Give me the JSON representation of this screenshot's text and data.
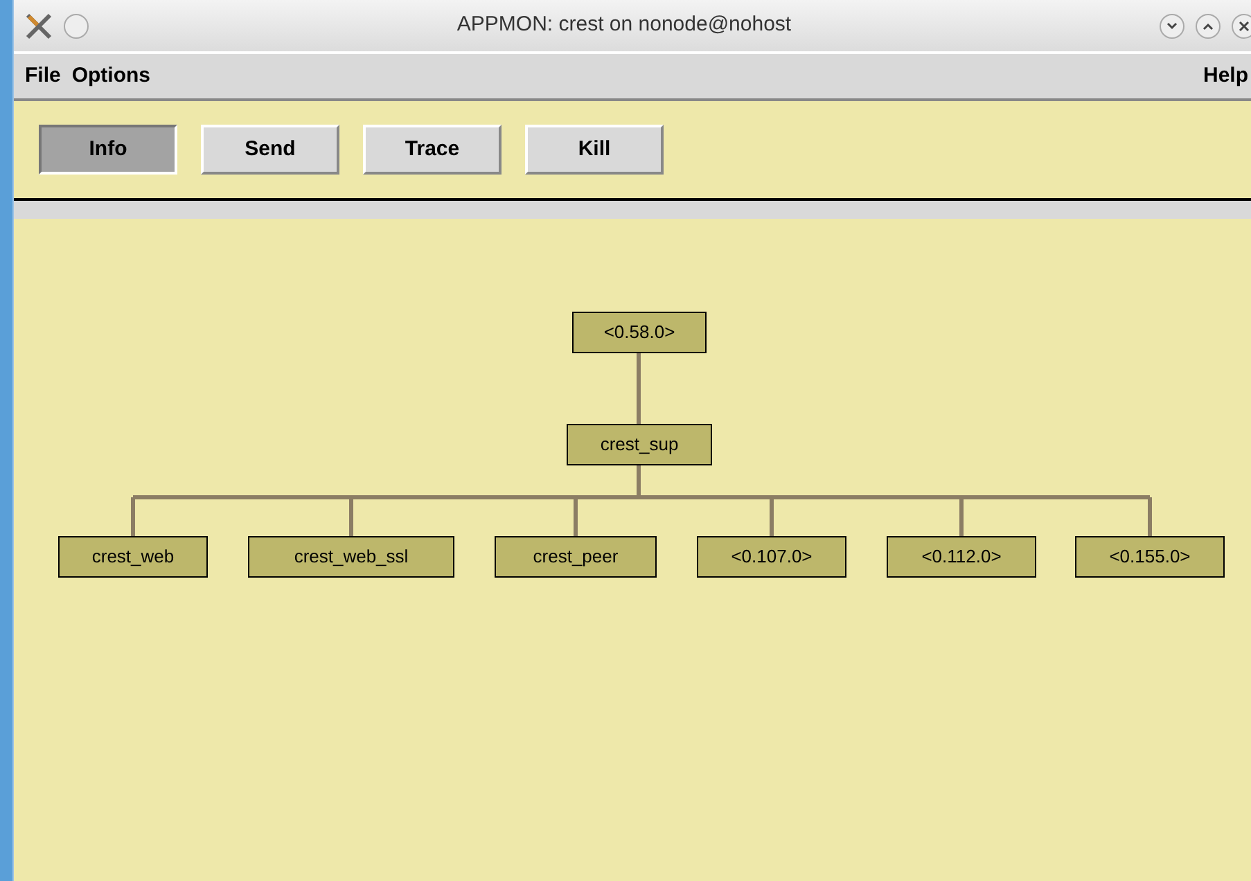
{
  "window": {
    "title": "APPMON: crest on nonode@nohost"
  },
  "menu": [
    "File",
    "Options"
  ],
  "help_menu": "Help",
  "toolbar": [
    {
      "label": "Info",
      "selected": true
    },
    {
      "label": "Send",
      "selected": false
    },
    {
      "label": "Trace",
      "selected": false
    },
    {
      "label": "Kill",
      "selected": false
    }
  ],
  "tree": {
    "label": "<0.58.0>",
    "children": [
      {
        "label": "crest_sup",
        "children": [
          {
            "label": "crest_web"
          },
          {
            "label": "crest_web_ssl"
          },
          {
            "label": "crest_peer"
          },
          {
            "label": "<0.107.0>"
          },
          {
            "label": "<0.112.0>"
          },
          {
            "label": "<0.155.0>"
          }
        ]
      }
    ]
  }
}
